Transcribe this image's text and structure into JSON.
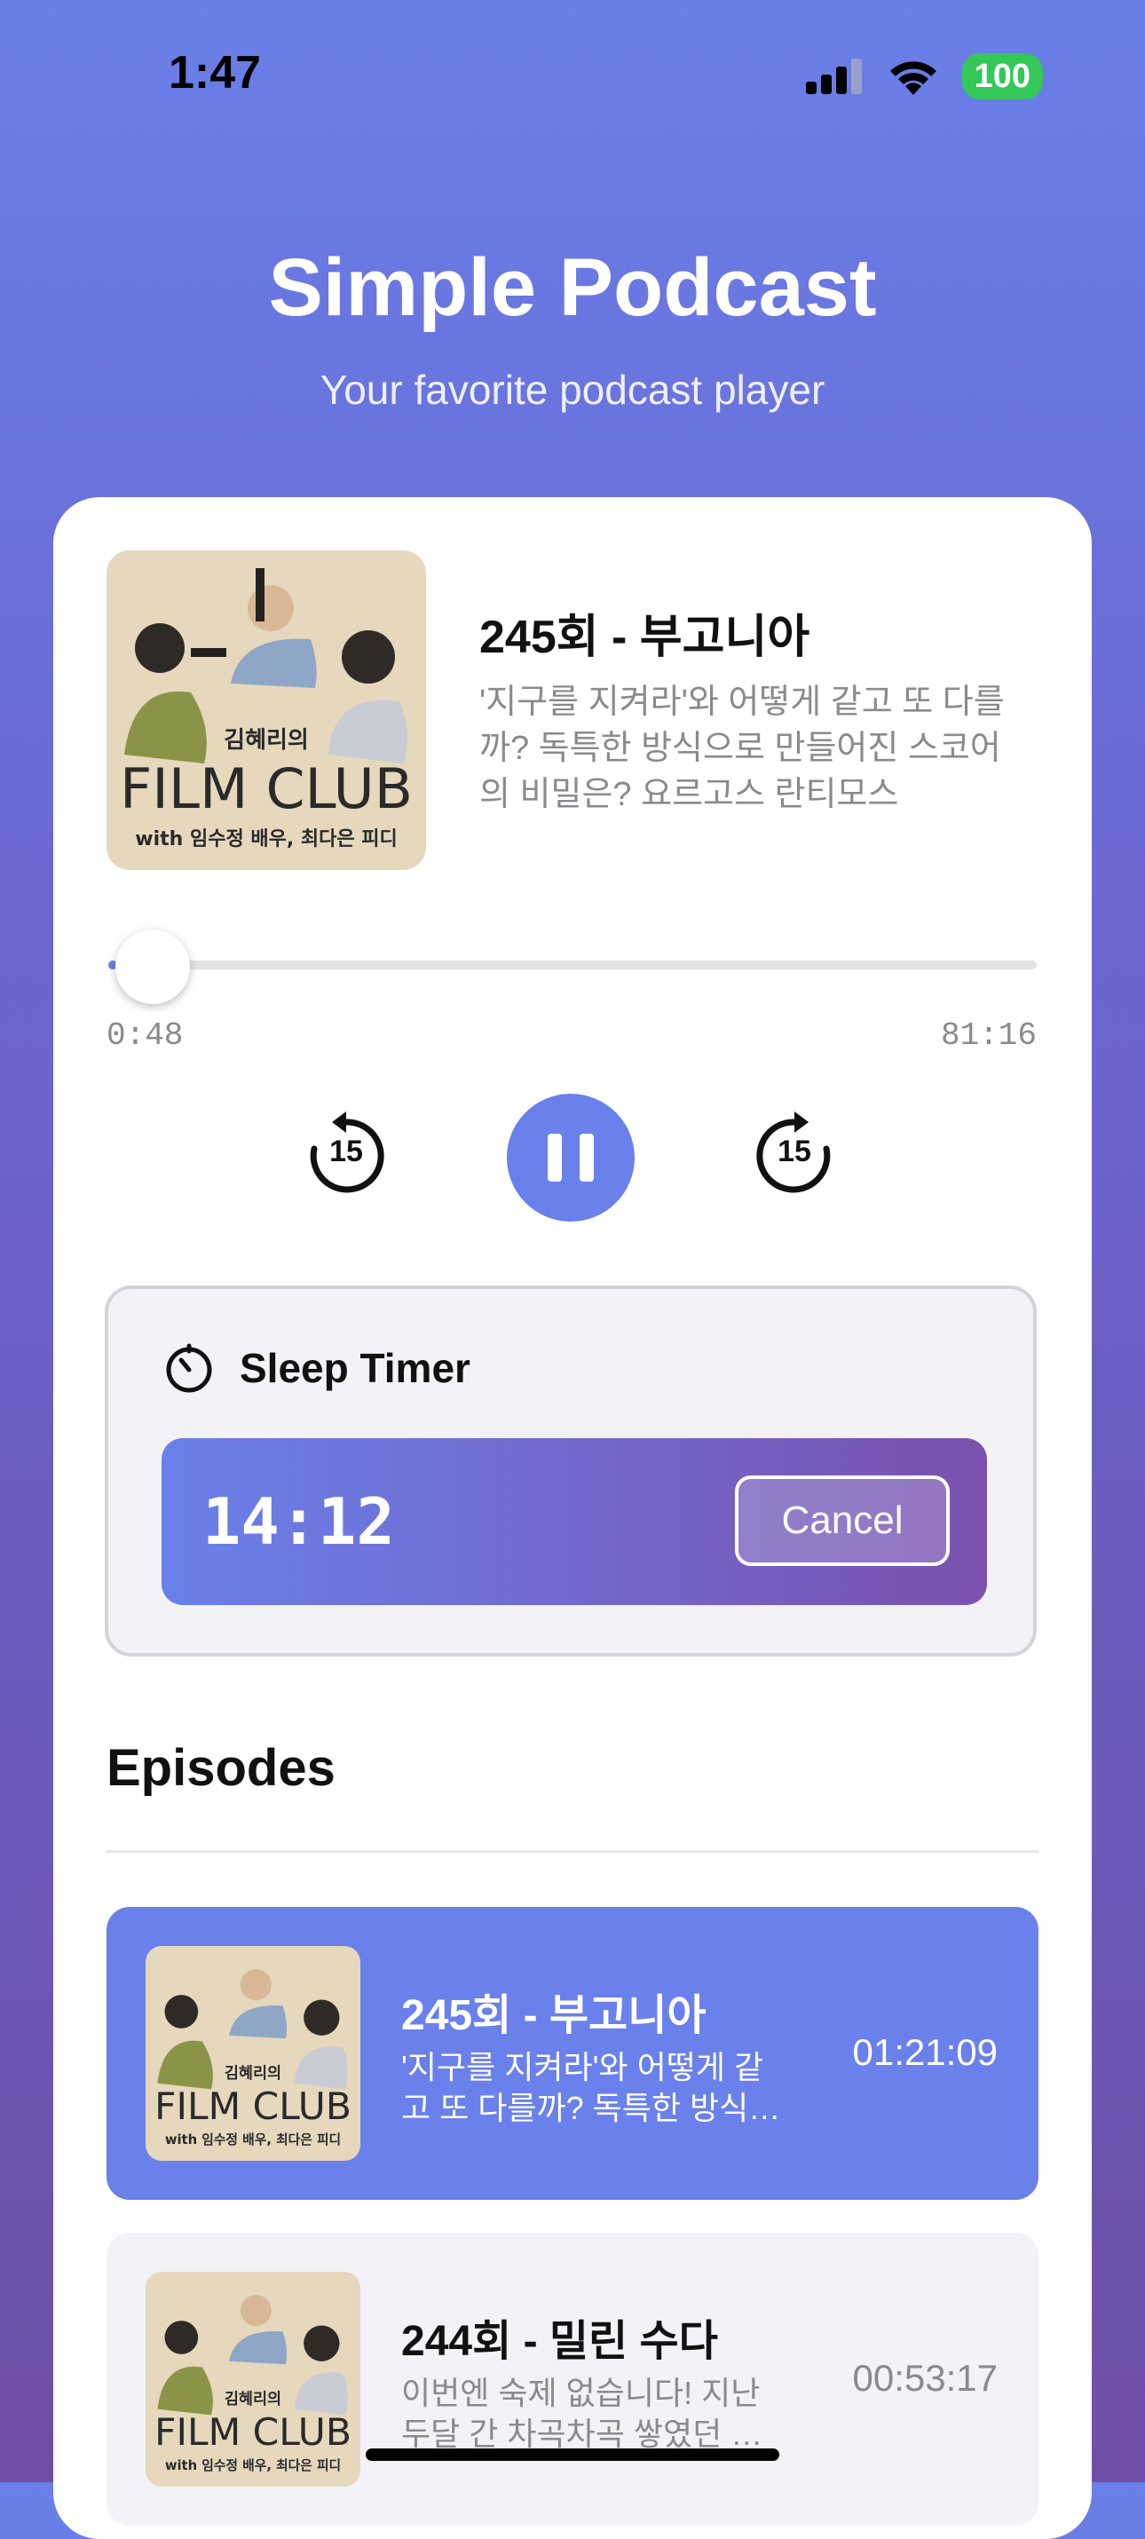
{
  "status_bar": {
    "time": "1:47",
    "battery": "100"
  },
  "app": {
    "title": "Simple Podcast",
    "subtitle": "Your favorite podcast player"
  },
  "artwork": {
    "top_text": "김혜리의",
    "main_text": "FILM CLUB",
    "bottom_text": "with 임수정 배우, 최다은 피디"
  },
  "now_playing": {
    "title": "245회 - 부고니아",
    "description": "'지구를 지켜라'와 어떻게 같고 또 다를까? 독특한 방식으로 만들어진 스코어의 비밀은? 요르고스 란티모스",
    "elapsed": "0:48",
    "total": "81:16",
    "progress": 0.0098
  },
  "controls": {
    "skip_back": "15",
    "skip_forward": "15"
  },
  "sleep_timer": {
    "label": "Sleep Timer",
    "remaining": "14:12",
    "cancel_label": "Cancel"
  },
  "episodes": {
    "title": "Episodes",
    "items": [
      {
        "title": "245회 - 부고니아",
        "description": "'지구를 지켜라'와 어떻게 같고 또 다를까? 독특한 방식으로",
        "duration": "01:21:09",
        "active": true
      },
      {
        "title": "244회 - 밀린 수다",
        "description": "이번엔 숙제 없습니다! 지난 두달 간 차곡차곡 쌓였던 클로징",
        "duration": "00:53:17",
        "active": false
      }
    ]
  },
  "colors": {
    "accent": "#6a80ea",
    "timer_gradient_end": "#7a52ae",
    "background_top": "#6a7fe8",
    "background_bottom": "#6e4fa6"
  }
}
